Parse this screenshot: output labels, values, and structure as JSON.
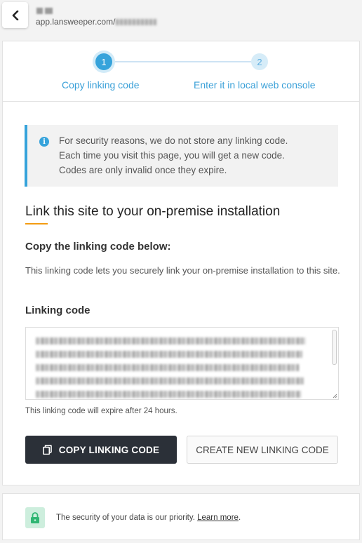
{
  "header": {
    "url_prefix": "app.lansweeper.com/"
  },
  "stepper": {
    "steps": [
      {
        "number": "1",
        "label": "Copy linking code"
      },
      {
        "number": "2",
        "label": "Enter it in local web console"
      }
    ]
  },
  "info": {
    "line1": "For security reasons, we do not store any linking code.",
    "line2": "Each time you visit this page, you will get a new code.",
    "line3": "Codes are only invalid once they expire."
  },
  "main": {
    "heading": "Link this site to your on-premise installation",
    "subheading": "Copy the linking code below:",
    "description": "This linking code lets you securely link your on-premise installation to this site.",
    "code_label": "Linking code",
    "expiry_note": "This linking code will expire after 24 hours.",
    "copy_button": "COPY LINKING CODE",
    "new_button": "CREATE NEW LINKING CODE"
  },
  "footer": {
    "text": "The security of your data is our priority. ",
    "link": "Learn more",
    "suffix": "."
  },
  "colors": {
    "accent": "#36a3db",
    "underline": "#f39c12",
    "dark_button": "#2b3038",
    "lock_bg": "#cdeedd"
  },
  "icons": {
    "back": "chevron-left-icon",
    "info": "info-icon",
    "copy": "copy-icon",
    "lock": "lock-icon"
  }
}
